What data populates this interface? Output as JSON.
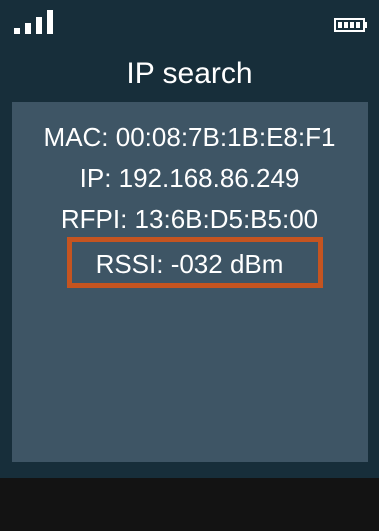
{
  "status_bar": {
    "signal_icon": "signal-strength-icon",
    "battery_icon": "battery-full-icon"
  },
  "header": {
    "title": "IP search"
  },
  "info": {
    "mac": "MAC: 00:08:7B:1B:E8:F1",
    "ip": "IP: 192.168.86.249",
    "rfpi": "RFPI: 13:6B:D5:B5:00",
    "rssi": "RSSI: -032 dBm"
  },
  "colors": {
    "background": "#172e3a",
    "panel": "#3e5565",
    "highlight": "#c55420",
    "text": "#ffffff"
  }
}
